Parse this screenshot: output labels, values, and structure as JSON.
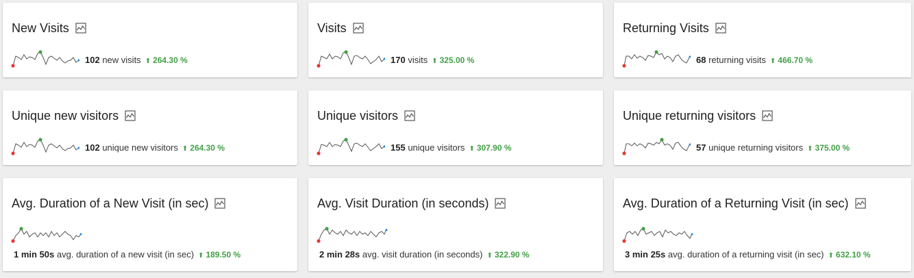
{
  "cards": [
    {
      "title": "New Visits",
      "value": "102",
      "label": "new visits",
      "change": "264.30 %"
    },
    {
      "title": "Visits",
      "value": "170",
      "label": "visits",
      "change": "325.00 %"
    },
    {
      "title": "Returning Visits",
      "value": "68",
      "label": "returning visits",
      "change": "466.70 %"
    },
    {
      "title": "Unique new visitors",
      "value": "102",
      "label": "unique new visitors",
      "change": "264.30 %"
    },
    {
      "title": "Unique visitors",
      "value": "155",
      "label": "unique visitors",
      "change": "307.90 %"
    },
    {
      "title": "Unique returning visitors",
      "value": "57",
      "label": "unique returning visitors",
      "change": "375.00 %"
    },
    {
      "title": "Avg. Duration of a New Visit (in sec)",
      "value": "1 min 50s",
      "label": "avg. duration of a new visit (in sec)",
      "change": "189.50 %"
    },
    {
      "title": "Avg. Visit Duration (in seconds)",
      "value": "2 min 28s",
      "label": "avg. visit duration (in seconds)",
      "change": "322.90 %"
    },
    {
      "title": "Avg. Duration of a Returning Visit (in sec)",
      "value": "3 min 25s",
      "label": "avg. duration of a returning visit (in sec)",
      "change": "632.10 %"
    }
  ],
  "icons": {
    "evolution": "evolution-graph-icon",
    "trend": "arrow-up-icon"
  },
  "colors": {
    "positive": "#43a047",
    "min_point": "#e53935",
    "max_point": "#43a047",
    "last_point": "#1e88e5",
    "line": "#555555"
  }
}
